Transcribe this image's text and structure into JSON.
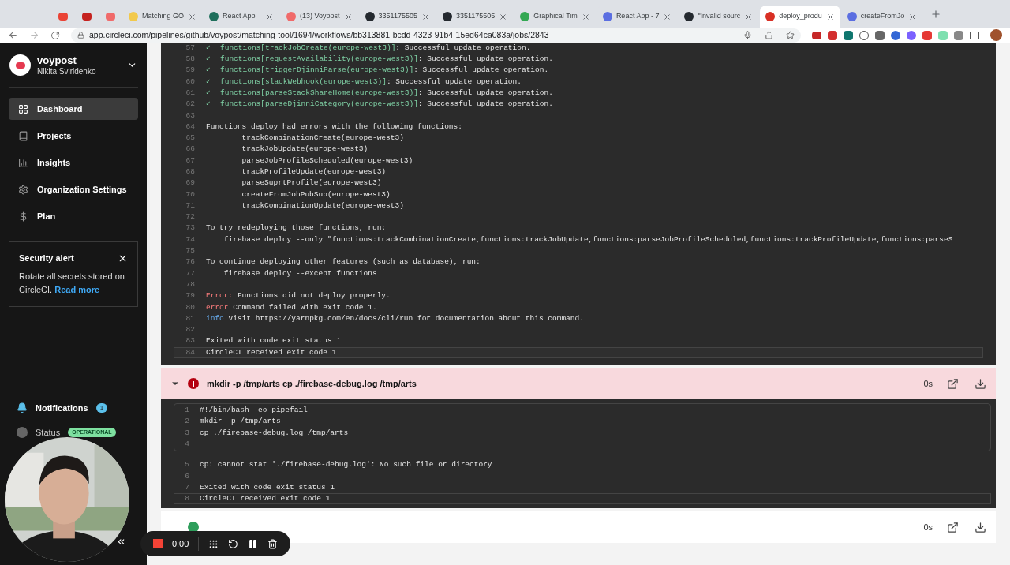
{
  "browser": {
    "tabs": [
      {
        "kind": "pinned",
        "color": "#ea4335",
        "selected": false
      },
      {
        "kind": "pinned",
        "color": "#c5221f",
        "selected": false
      },
      {
        "kind": "pinned",
        "color": "#f06a6a",
        "selected": false
      },
      {
        "kind": "tab",
        "title": "Matching GO",
        "color": "#f2c94c",
        "selected": false
      },
      {
        "kind": "tab",
        "title": "React App",
        "color": "#1f6f5c",
        "selected": false
      },
      {
        "kind": "tab",
        "title": "(13) Voypost",
        "color": "#f06a6a",
        "selected": false
      },
      {
        "kind": "tab",
        "title": "3351175505",
        "color": "#24292f",
        "selected": false
      },
      {
        "kind": "tab",
        "title": "3351175505",
        "color": "#24292f",
        "selected": false
      },
      {
        "kind": "tab",
        "title": "Graphical Tim",
        "color": "#34a853",
        "selected": false
      },
      {
        "kind": "tab",
        "title": "React App - 7",
        "color": "#5b6ee1",
        "selected": false
      },
      {
        "kind": "tab",
        "title": "\"Invalid sourc",
        "color": "#24292f",
        "selected": false
      },
      {
        "kind": "tab",
        "title": "deploy_produ",
        "color": "#d93025",
        "selected": true
      },
      {
        "kind": "tab",
        "title": "createFromJo",
        "color": "#5b6ee1",
        "selected": false
      }
    ],
    "url": "app.circleci.com/pipelines/github/voypost/matching-tool/1694/workflows/bb313881-bcdd-4323-91b4-15ed64ca083a/jobs/2843"
  },
  "sidebar": {
    "org": "voypost",
    "user": "Nikita Sviridenko",
    "items": [
      {
        "label": "Dashboard",
        "selected": true
      },
      {
        "label": "Projects",
        "selected": false
      },
      {
        "label": "Insights",
        "selected": false
      },
      {
        "label": "Organization Settings",
        "selected": false
      },
      {
        "label": "Plan",
        "selected": false
      }
    ],
    "alert": {
      "title": "Security alert",
      "text": "Rotate all secrets stored on CircleCI.",
      "link": "Read more"
    },
    "notifications": {
      "label": "Notifications",
      "count": "1"
    },
    "status": {
      "label": "Status",
      "badge": "OPERATIONAL"
    }
  },
  "log": {
    "lines": [
      {
        "num": "57",
        "kind": "success",
        "mark": "✓",
        "prefix": "functions[trackJobCreate(europe-west3)]",
        "text": ": Successful update operation.",
        "highlighted": false
      },
      {
        "num": "58",
        "kind": "success",
        "mark": "✓",
        "prefix": "functions[requestAvailability(europe-west3)]",
        "text": ": Successful update operation.",
        "highlighted": false
      },
      {
        "num": "59",
        "kind": "success",
        "mark": "✓",
        "prefix": "functions[triggerDjinniParse(europe-west3)]",
        "text": ": Successful update operation.",
        "highlighted": false
      },
      {
        "num": "60",
        "kind": "success",
        "mark": "✓",
        "prefix": "functions[slackWebhook(europe-west3)]",
        "text": ": Successful update operation.",
        "highlighted": false
      },
      {
        "num": "61",
        "kind": "success",
        "mark": "✓",
        "prefix": "functions[parseStackShareHome(europe-west3)]",
        "text": ": Successful update operation.",
        "highlighted": false
      },
      {
        "num": "62",
        "kind": "success",
        "mark": "✓",
        "prefix": "functions[parseDjinniCategory(europe-west3)]",
        "text": ": Successful update operation.",
        "highlighted": false
      },
      {
        "num": "63",
        "kind": "blank",
        "highlighted": false
      },
      {
        "num": "64",
        "kind": "plain",
        "text": "Functions deploy had errors with the following functions:",
        "highlighted": false
      },
      {
        "num": "65",
        "kind": "plain",
        "text": "        trackCombinationCreate(europe-west3)",
        "highlighted": false
      },
      {
        "num": "66",
        "kind": "plain",
        "text": "        trackJobUpdate(europe-west3)",
        "highlighted": false
      },
      {
        "num": "67",
        "kind": "plain",
        "text": "        parseJobProfileScheduled(europe-west3)",
        "highlighted": false
      },
      {
        "num": "68",
        "kind": "plain",
        "text": "        trackProfileUpdate(europe-west3)",
        "highlighted": false
      },
      {
        "num": "69",
        "kind": "plain",
        "text": "        parseSuprtProfile(europe-west3)",
        "highlighted": false
      },
      {
        "num": "70",
        "kind": "plain",
        "text": "        createFromJobPubSub(europe-west3)",
        "highlighted": false
      },
      {
        "num": "71",
        "kind": "plain",
        "text": "        trackCombinationUpdate(europe-west3)",
        "highlighted": false
      },
      {
        "num": "72",
        "kind": "blank",
        "highlighted": false
      },
      {
        "num": "73",
        "kind": "plain",
        "text": "To try redeploying those functions, run:",
        "highlighted": false
      },
      {
        "num": "74",
        "kind": "plain",
        "text": "    firebase deploy --only \"functions:trackCombinationCreate,functions:trackJobUpdate,functions:parseJobProfileScheduled,functions:trackProfileUpdate,functions:parseS",
        "highlighted": false
      },
      {
        "num": "75",
        "kind": "blank",
        "highlighted": false
      },
      {
        "num": "76",
        "kind": "plain",
        "text": "To continue deploying other features (such as database), run:",
        "highlighted": false
      },
      {
        "num": "77",
        "kind": "plain",
        "text": "    firebase deploy --except functions",
        "highlighted": false
      },
      {
        "num": "78",
        "kind": "blank",
        "highlighted": false
      },
      {
        "num": "79",
        "kind": "error",
        "prefix": "Error:",
        "text": " Functions did not deploy properly.",
        "highlighted": false
      },
      {
        "num": "80",
        "kind": "error",
        "prefix": "error",
        "text": " Command failed with exit code 1.",
        "highlighted": false
      },
      {
        "num": "81",
        "kind": "info",
        "prefix": "info",
        "text": " Visit https://yarnpkg.com/en/docs/cli/run for documentation about this command.",
        "highlighted": false
      },
      {
        "num": "82",
        "kind": "blank",
        "highlighted": false
      },
      {
        "num": "83",
        "kind": "plain",
        "text": "Exited with code exit status 1",
        "highlighted": false
      },
      {
        "num": "84",
        "kind": "plain",
        "text": "CircleCI received exit code 1",
        "highlighted": true
      }
    ]
  },
  "steps": [
    {
      "failed": true,
      "expanded": true,
      "title": "mkdir -p /tmp/arts cp ./firebase-debug.log /tmp/arts",
      "duration": "0s",
      "script": [
        {
          "num": "1",
          "text": "#!/bin/bash -eo pipefail"
        },
        {
          "num": "2",
          "text": "mkdir -p /tmp/arts"
        },
        {
          "num": "3",
          "text": "cp ./firebase-debug.log /tmp/arts"
        },
        {
          "num": "4"
        }
      ],
      "output": [
        {
          "num": "5",
          "text": "cp: cannot stat './firebase-debug.log': No such file or directory",
          "highlighted": false
        },
        {
          "num": "6",
          "highlighted": false
        },
        {
          "num": "7",
          "text": "Exited with code exit status 1",
          "highlighted": false
        },
        {
          "num": "8",
          "text": "CircleCI received exit code 1",
          "highlighted": true
        }
      ]
    },
    {
      "failed": false,
      "expanded": false,
      "duration": "0s"
    }
  ],
  "recorder": {
    "time": "0:00"
  }
}
